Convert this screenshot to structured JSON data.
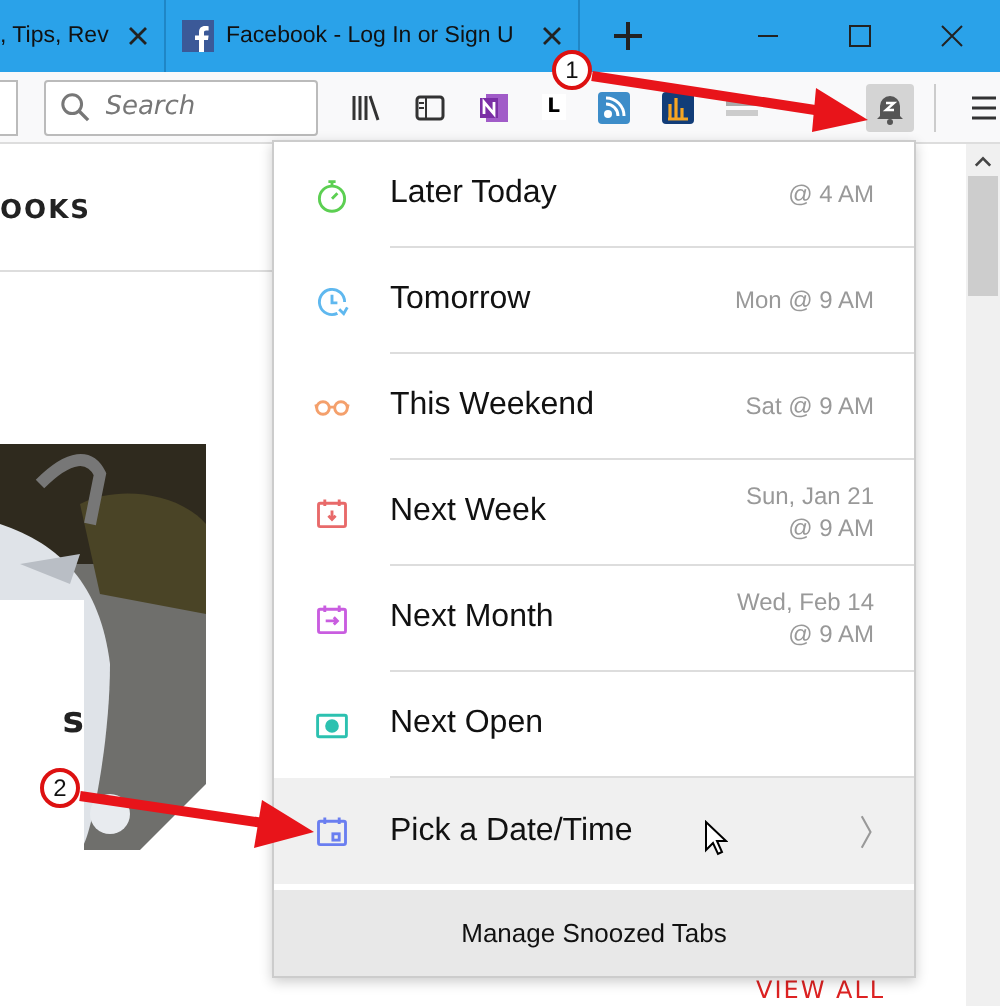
{
  "tabs": [
    {
      "title": ", Tips, Rev"
    },
    {
      "title": "Facebook - Log In or Sign U"
    }
  ],
  "toolbar": {
    "search": {
      "placeholder": "Search"
    },
    "letter_button": "L"
  },
  "page": {
    "heading": "OOKS",
    "card_text": "s",
    "link": "VIEW ALL"
  },
  "snooze_menu": {
    "items": [
      {
        "label": "Later Today",
        "detail": [
          "@ 4 AM"
        ],
        "color": "#5ccf52",
        "highlighted": false,
        "submenu": false
      },
      {
        "label": "Tomorrow",
        "detail": [
          "Mon @ 9 AM"
        ],
        "color": "#5fb8ef",
        "highlighted": false,
        "submenu": false
      },
      {
        "label": "This Weekend",
        "detail": [
          "Sat @ 9 AM"
        ],
        "color": "#f4a06c",
        "highlighted": false,
        "submenu": false
      },
      {
        "label": "Next Week",
        "detail": [
          "Sun, Jan 21",
          "@ 9 AM"
        ],
        "color": "#e86a6a",
        "highlighted": false,
        "submenu": false
      },
      {
        "label": "Next Month",
        "detail": [
          "Wed, Feb 14",
          "@ 9 AM"
        ],
        "color": "#c95de0",
        "highlighted": false,
        "submenu": false
      },
      {
        "label": "Next Open",
        "color": "#2cc1b0",
        "highlighted": false,
        "submenu": false
      },
      {
        "label": "Pick a Date/Time",
        "color": "#6a7ef0",
        "highlighted": true,
        "submenu": true
      }
    ],
    "footer": "Manage Snoozed Tabs"
  },
  "annotations": [
    {
      "number": "1"
    },
    {
      "number": "2"
    }
  ]
}
